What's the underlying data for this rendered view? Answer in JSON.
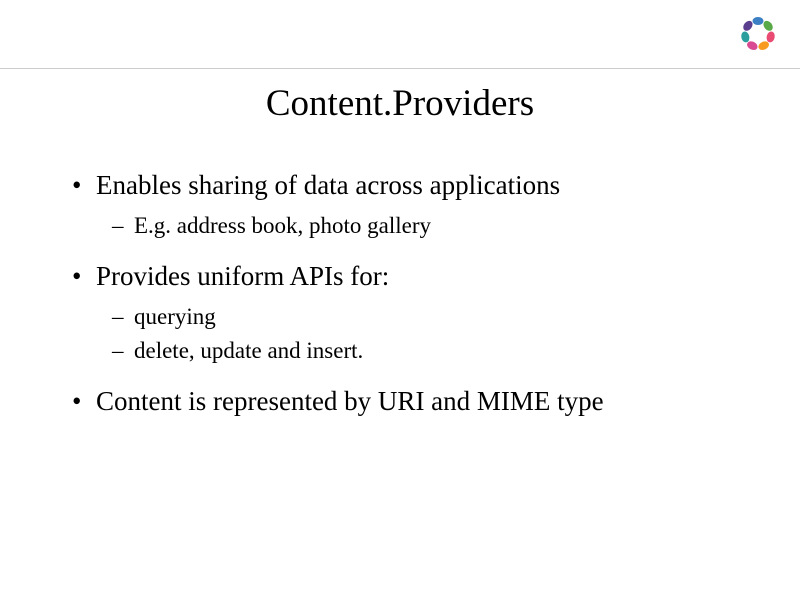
{
  "slide": {
    "title": "Content.Providers",
    "bullets": [
      {
        "text": "Enables sharing of data across applications",
        "sub": [
          {
            "text": "E.g. address book, photo gallery"
          }
        ]
      },
      {
        "text": "Provides uniform APIs for:",
        "sub": [
          {
            "text": "querying"
          },
          {
            "text": "delete, update and insert."
          }
        ]
      },
      {
        "text": "Content is represented by URI and MIME type",
        "sub": []
      }
    ]
  },
  "logo": {
    "petals": [
      {
        "color": "#3b7fc4",
        "angle": 0
      },
      {
        "color": "#5aa948",
        "angle": 51
      },
      {
        "color": "#e94b73",
        "angle": 103
      },
      {
        "color": "#f79a1f",
        "angle": 154
      },
      {
        "color": "#d84a91",
        "angle": 206
      },
      {
        "color": "#2b9e9e",
        "angle": 257
      },
      {
        "color": "#5b3e8e",
        "angle": 309
      }
    ]
  }
}
